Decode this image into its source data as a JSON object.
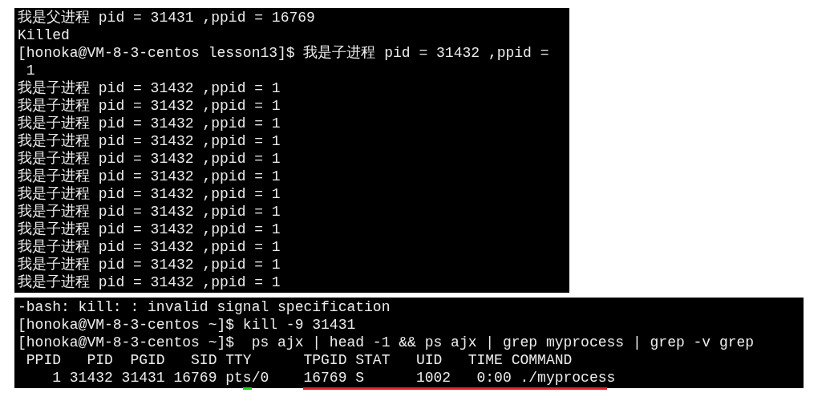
{
  "top_terminal": {
    "lines": [
      "我是父进程 pid = 31431 ,ppid = 16769",
      "Killed",
      "[honoka@VM-8-3-centos lesson13]$ 我是子进程 pid = 31432 ,ppid =",
      " 1",
      "我是子进程 pid = 31432 ,ppid = 1",
      "我是子进程 pid = 31432 ,ppid = 1",
      "我是子进程 pid = 31432 ,ppid = 1",
      "我是子进程 pid = 31432 ,ppid = 1",
      "我是子进程 pid = 31432 ,ppid = 1",
      "我是子进程 pid = 31432 ,ppid = 1",
      "我是子进程 pid = 31432 ,ppid = 1",
      "我是子进程 pid = 31432 ,ppid = 1",
      "我是子进程 pid = 31432 ,ppid = 1",
      "我是子进程 pid = 31432 ,ppid = 1",
      "我是子进程 pid = 31432 ,ppid = 1",
      "我是子进程 pid = 31432 ,ppid = 1"
    ]
  },
  "bottom_terminal": {
    "lines": [
      "-bash: kill: : invalid signal specification",
      "[honoka@VM-8-3-centos ~]$ kill -9 31431",
      "[honoka@VM-8-3-centos ~]$  ps ajx | head -1 && ps ajx | grep myprocess | grep -v grep",
      " PPID   PID  PGID   SID TTY      TPGID STAT   UID   TIME COMMAND",
      "    1 31432 31431 16769 pts/0    16769 S      1002   0:00 ./myprocess"
    ]
  }
}
